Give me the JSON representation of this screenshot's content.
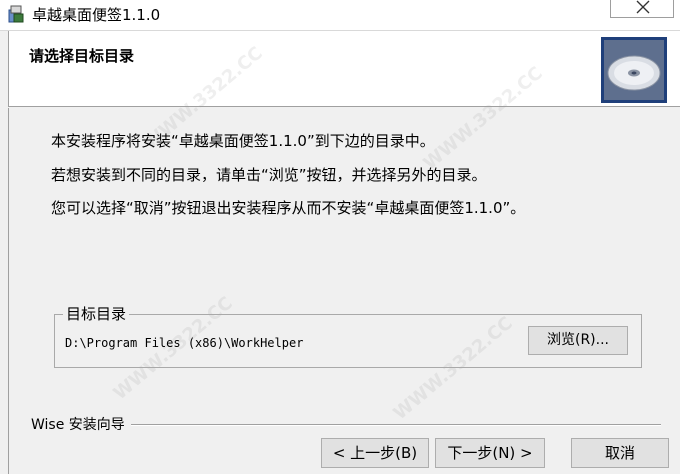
{
  "window": {
    "title": "卓越桌面便签1.1.0",
    "app_icon": "installer-icon",
    "close_icon": "close-icon"
  },
  "header": {
    "title": "请选择目标目录",
    "icon": "cd-disc-icon"
  },
  "body": {
    "line1": "本安装程序将安装“卓越桌面便签1.1.0”到下边的目录中。",
    "line2": "若想安装到不同的目录，请单击“浏览”按钮，并选择另外的目录。",
    "line3": "您可以选择“取消”按钮退出安装程序从而不安装“卓越桌面便签1.1.0”。"
  },
  "destination": {
    "group_label": "目标目录",
    "path": "D:\\Program Files (x86)\\WorkHelper",
    "browse_label": "浏览(R)..."
  },
  "footer": {
    "brand": "Wise 安装向导",
    "back_label": "< 上一步(B)",
    "next_label": "下一步(N) >",
    "cancel_label": "取消"
  },
  "watermark": {
    "text": "WWW.3322.CC"
  },
  "colors": {
    "dialog_bg": "#f0f0f0",
    "header_bg": "#ffffff",
    "button_bg": "#e1e1e1",
    "icon_frame": "#1f3f7a"
  }
}
